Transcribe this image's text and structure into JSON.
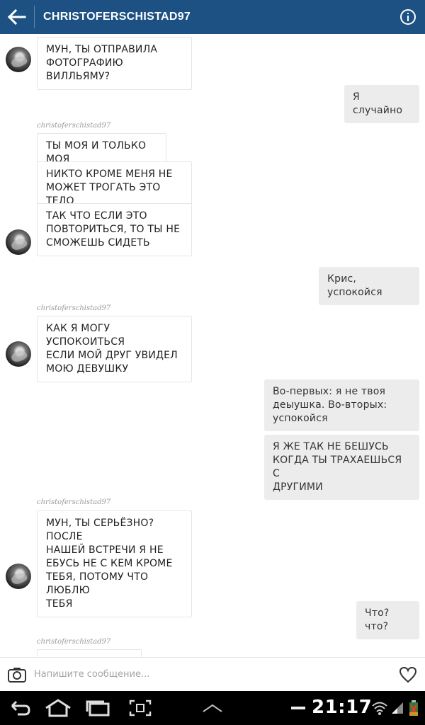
{
  "header": {
    "title": "CHRISTOFERSCHISTAD97",
    "colors": {
      "bar": "#1d5184"
    }
  },
  "messages": [
    {
      "side": "in",
      "lines": [
        "МУН, ТЫ ОТПРАВИЛА",
        "ФОТОГРАФИЮ ВИЛЛЬЯМУ?"
      ]
    },
    {
      "side": "out",
      "lines": [
        "Я случайно"
      ]
    },
    {
      "side": "in",
      "sender": "christoferschistad97",
      "lines": [
        "ТЫ МОЯ И ТОЛЬКО МОЯ"
      ]
    },
    {
      "side": "in",
      "lines": [
        "НИКТО КРОМЕ МЕНЯ НЕ",
        "МОЖЕТ ТРОГАТЬ ЭТО ТЕЛО"
      ]
    },
    {
      "side": "in",
      "lines": [
        "ТАК ЧТО ЕСЛИ ЭТО",
        "ПОВТОРИТЬСЯ, ТО ТЫ НЕ",
        "СМОЖЕШЬ СИДЕТЬ"
      ]
    },
    {
      "side": "out",
      "lines": [
        "Крис, успокойся"
      ]
    },
    {
      "side": "in",
      "sender": "christoferschistad97",
      "lines": [
        "КАК Я МОГУ УСПОКОИТЬСЯ",
        "ЕСЛИ МОЙ ДРУГ УВИДЕЛ",
        "МОЮ ДЕВУШКУ"
      ]
    },
    {
      "side": "out",
      "lines": [
        "Во-первых: я не твоя",
        "деыушка. Во-вторых:",
        "успокойся"
      ]
    },
    {
      "side": "out",
      "lines": [
        "Я ЖЕ ТАК НЕ БЕШУСЬ",
        "КОГДА ТЫ ТРАХАЕШЬСЯ С",
        "ДРУГИМИ"
      ]
    },
    {
      "side": "in",
      "sender": "christoferschistad97",
      "lines": [
        "МУН, ТЫ СЕРЬЁЗНО? ПОСЛЕ",
        "НАШЕЙ ВСТРЕЧИ Я НЕ",
        "ЕБУСЬ НЕ С КЕМ КРОМЕ",
        "ТЕБЯ, ПОТОМУ ЧТО ЛЮБЛЮ",
        "ТЕБЯ"
      ]
    },
    {
      "side": "out",
      "lines": [
        "Что?что?"
      ]
    },
    {
      "side": "in",
      "sender": "christoferschistad97",
      "lines": [
        ""
      ]
    }
  ],
  "input": {
    "placeholder": "Напишите сообщение..."
  },
  "statusbar": {
    "time": "21:17"
  },
  "icons": {
    "back": "arrow-left-icon",
    "info": "info-icon",
    "camera": "camera-icon",
    "heart": "heart-icon",
    "nav_back": "nav-back-icon",
    "nav_home": "nav-home-icon",
    "nav_recent": "nav-recent-apps-icon",
    "nav_screenshot": "screenshot-icon",
    "nav_up": "chevron-up-icon",
    "nav_minus": "minus-icon",
    "wifi": "wifi-icon",
    "signal": "signal-icon",
    "battery": "battery-icon"
  }
}
